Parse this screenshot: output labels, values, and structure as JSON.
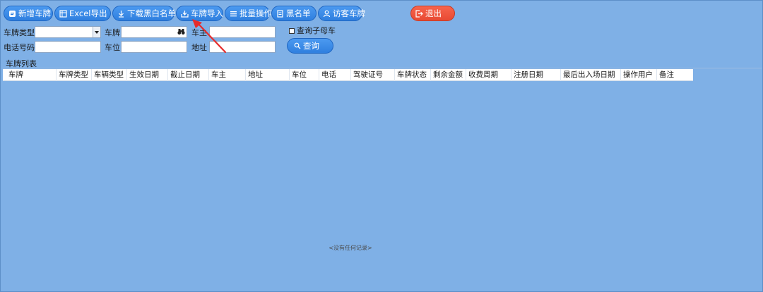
{
  "toolbar": {
    "add_plate": "新增车牌",
    "excel_export": "Excel导出",
    "download_blacklist": "下载黑白名单",
    "plate_import": "车牌导入",
    "batch_ops": "批量操作",
    "blacklist": "黑名单",
    "visitor_plate": "访客车牌",
    "exit": "退出"
  },
  "filters": {
    "plate_type_label": "车牌类型",
    "plate_type_value": "",
    "plate_label": "车牌",
    "plate_value": "",
    "owner_label": "车主",
    "owner_value": "",
    "phone_label": "电话号码",
    "phone_value": "",
    "space_label": "车位",
    "space_value": "",
    "address_label": "地址",
    "address_value": "",
    "query_sub_label": "查询子母车",
    "query_sub_checked": false,
    "query_button": "查询"
  },
  "list": {
    "title": "车牌列表",
    "columns": [
      "车牌",
      "车牌类型",
      "车辆类型",
      "生效日期",
      "截止日期",
      "车主",
      "地址",
      "车位",
      "电话",
      "驾驶证号",
      "车牌状态",
      "剩余金额",
      "收费周期",
      "注册日期",
      "最后出入场日期",
      "操作用户",
      "备注"
    ],
    "empty_text": "<没有任何记录>"
  },
  "colors": {
    "background": "#7fb0e6",
    "button_blue": "#2f7fdf",
    "button_red": "#e84a33",
    "annotation_arrow": "#e52b2b"
  }
}
